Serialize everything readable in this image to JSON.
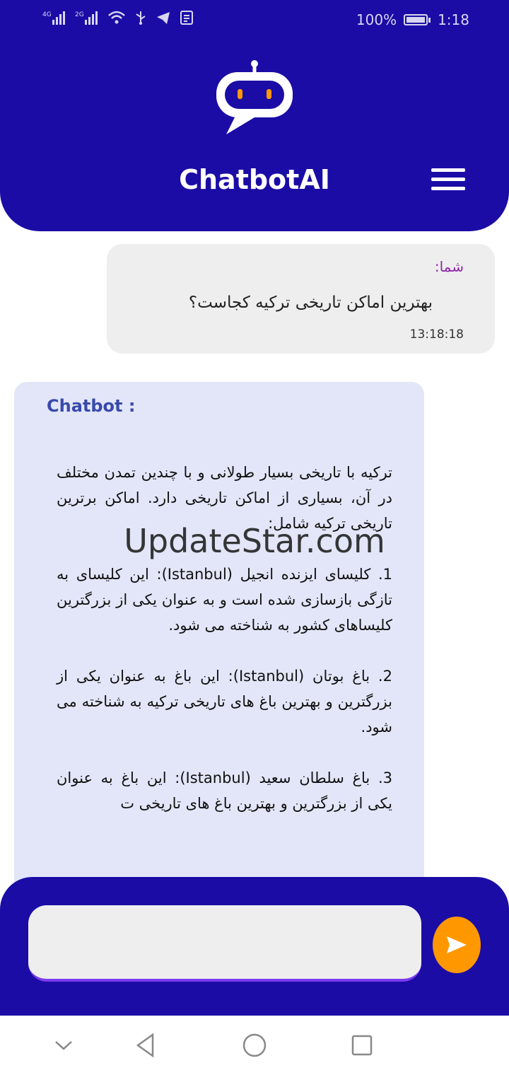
{
  "statusbar": {
    "signal1_label": "4G",
    "signal2_label": "2G",
    "battery_percent": "100%",
    "time": "1:18",
    "icons": [
      "signal-4g-icon",
      "signal-2g-icon",
      "wifi-icon",
      "usb-icon",
      "telegram-icon",
      "notes-icon",
      "battery-icon"
    ]
  },
  "header": {
    "title": "ChatbotAI",
    "logo_icon": "robot-chat-icon",
    "menu_icon": "hamburger-menu-icon"
  },
  "messages": {
    "user": {
      "label": "شما:",
      "text": "بهترین اماکن تاریخی ترکیه کجاست؟",
      "time": "13:18:18"
    },
    "bot": {
      "label": "Chatbot :",
      "text": "ترکیه با تاریخی بسیار طولانی و با چندین تمدن مختلف در آن، بسیاری از اماکن تاریخی دارد. اماکن برترین تاریخی ترکیه شامل:\n\n1. کلیسای ایزنده انجیل (Istanbul): این کلیسای به تازگی بازسازی شده است و به عنوان یکی از بزرگترین کلیساهای کشور به شناخته می شود.\n\n2. باغ بوتان (Istanbul): این باغ به عنوان یکی از بزرگترین و بهترین باغ های تاریخی ترکیه به شناخته می شود.\n\n3. باغ سلطان سعید (Istanbul): این باغ به عنوان یکی از بزرگترین و بهترین باغ های تاریخی ت"
    }
  },
  "watermark": "UpdateStar.com",
  "composer": {
    "placeholder": "",
    "send_icon": "send-icon"
  },
  "navbar": {
    "icons": [
      "nav-collapse-icon",
      "nav-back-icon",
      "nav-home-icon",
      "nav-recents-icon"
    ]
  },
  "colors": {
    "primary": "#1b0ca6",
    "accent": "#ff9800",
    "bot_bubble": "#e3e6f8",
    "user_bubble": "#eeeeee",
    "user_label": "#8e24aa",
    "bot_label": "#3949ab"
  }
}
